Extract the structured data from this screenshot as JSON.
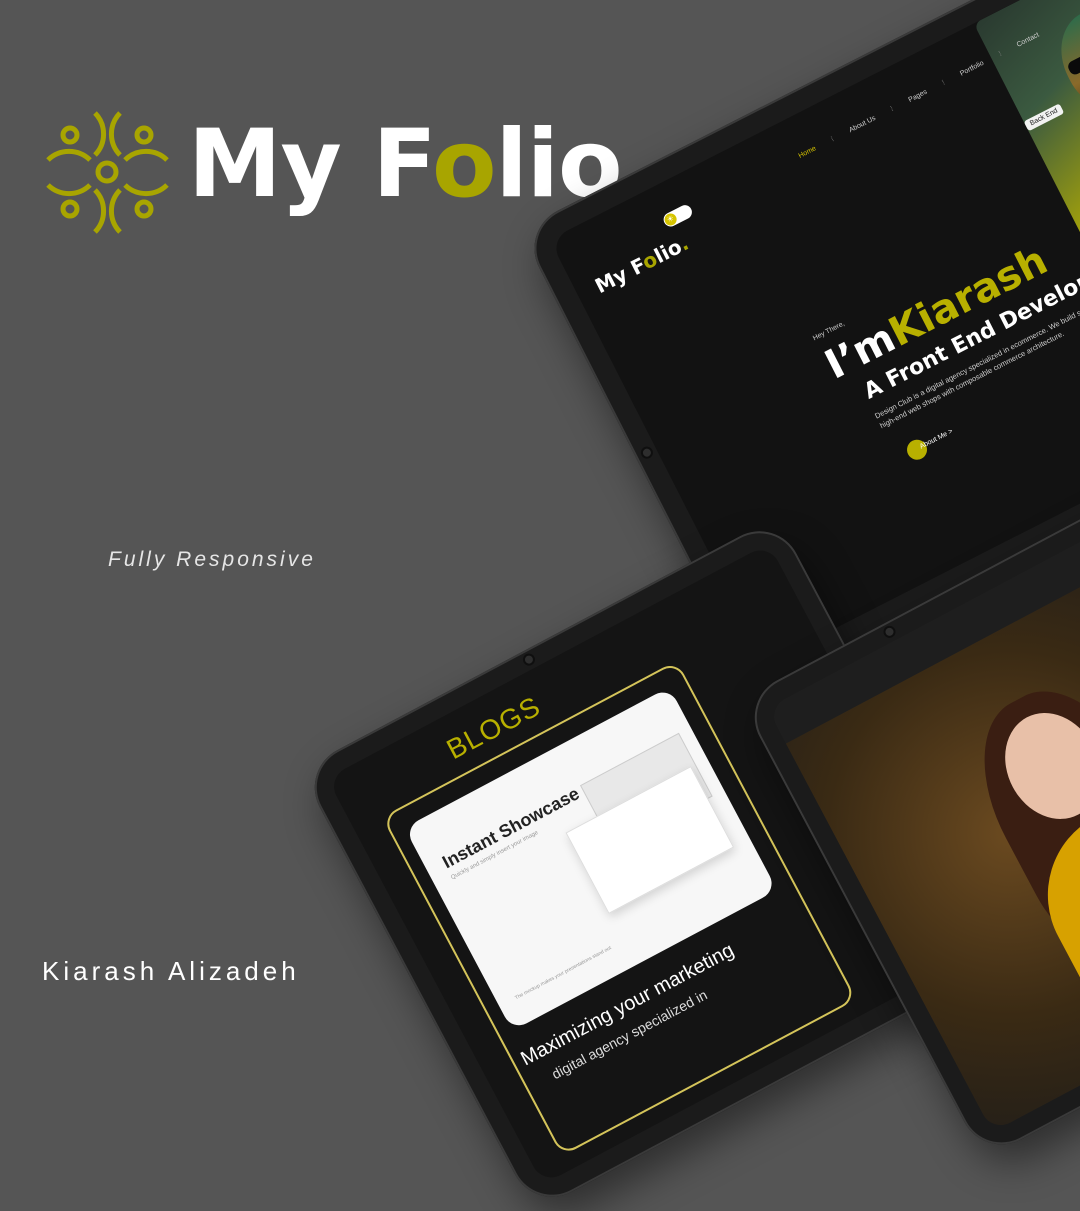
{
  "brand": {
    "title_pre": "My F",
    "title_o": "o",
    "title_post": "lio",
    "title_dot": ".",
    "accent": "#a8a500"
  },
  "tagline": "Fully Responsive",
  "author": "Kiarash Alizadeh",
  "hero_tablet": {
    "logo_pre": "My F",
    "logo_o": "o",
    "logo_post": "lio",
    "logo_dot": ".",
    "nav": [
      "Home",
      "About Us",
      "Pages",
      "Portfolio",
      "Contact"
    ],
    "badge": "Back End",
    "greeting": "Hey There,",
    "im": "I’m",
    "name": "Kiarash",
    "role": "A Front End Developer",
    "description": "Design Club is a digital agency specialized in ecommerce. We build scalable, high-end web shops with composable commerce architecture.",
    "cta": "About Me >"
  },
  "blog_tablet": {
    "title": "BLOGS",
    "card_title": "Instant Showcase",
    "card_subtitle": "Quickly and simply insert your image",
    "card_footer": "The mockup makes your presentations stand out",
    "headline": "Maximizing your marketing",
    "text": "digital agency specialized in"
  }
}
